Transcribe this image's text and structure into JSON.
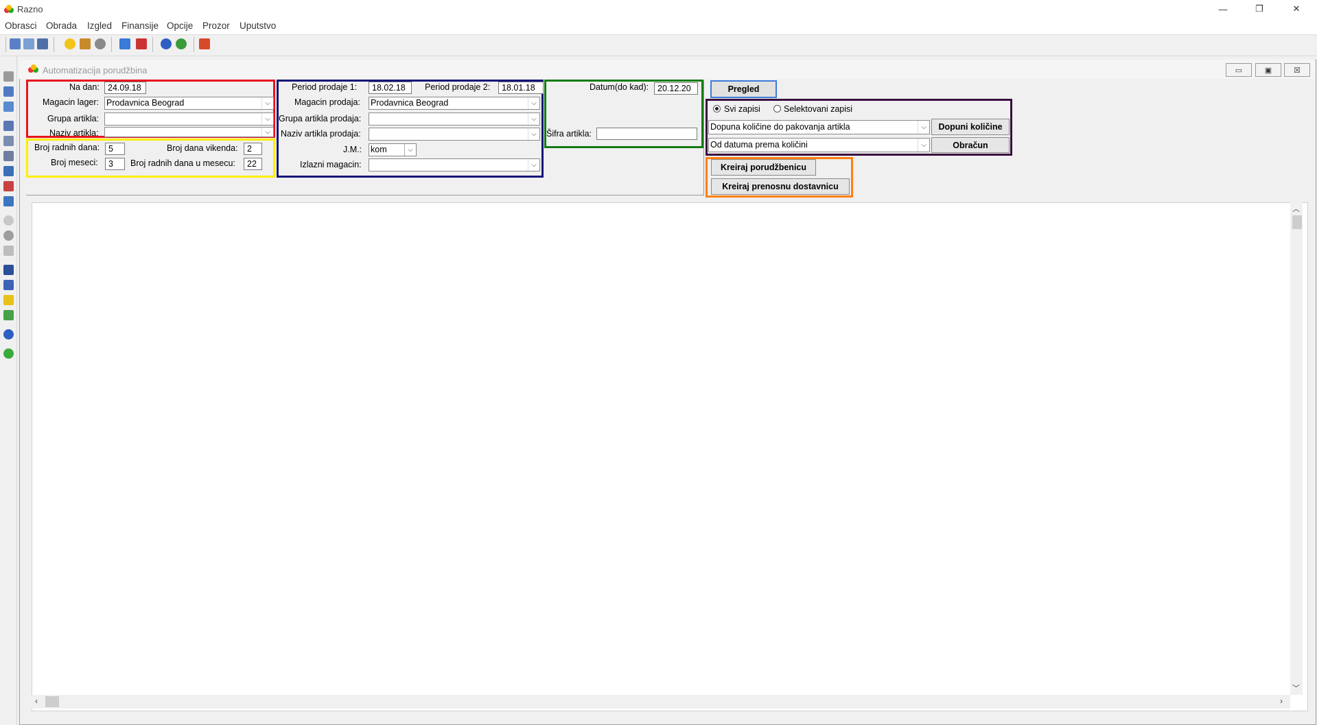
{
  "app": {
    "title": "Razno"
  },
  "window_controls": {
    "minimize": "—",
    "restore": "❐",
    "close": "✕"
  },
  "menu": [
    "Obrasci",
    "Obrada",
    "Izgled",
    "Finansije",
    "Opcije",
    "Prozor",
    "Uputstvo"
  ],
  "child": {
    "title": "Automatizacija porudžbina",
    "controls": {
      "minimize": "▭",
      "restore": "▣",
      "close": "☒"
    }
  },
  "red_section": {
    "na_dan_label": "Na dan:",
    "na_dan_value": "24.09.18",
    "magacin_lager_label": "Magacin lager:",
    "magacin_lager_value": "Prodavnica Beograd",
    "grupa_artikla_label": "Grupa artikla:",
    "grupa_artikla_value": "",
    "naziv_artikla_label": "Naziv artikla:",
    "naziv_artikla_value": ""
  },
  "yellow_section": {
    "broj_radnih_dana_label": "Broj radnih dana:",
    "broj_radnih_dana_value": "5",
    "broj_dana_vikenda_label": "Broj dana vikenda:",
    "broj_dana_vikenda_value": "2",
    "broj_meseci_label": "Broj meseci:",
    "broj_meseci_value": "3",
    "broj_radnih_dana_mesec_label": "Broj radnih dana u mesecu:",
    "broj_radnih_dana_mesec_value": "22"
  },
  "blue_section": {
    "period1_label": "Period prodaje 1:",
    "period1_value": "18.02.18",
    "period2_label": "Period prodaje 2:",
    "period2_value": "18.01.18",
    "magacin_prodaja_label": "Magacin prodaja:",
    "magacin_prodaja_value": "Prodavnica Beograd",
    "grupa_prodaja_label": "Grupa artikla prodaja:",
    "grupa_prodaja_value": "",
    "naziv_prodaja_label": "Naziv artikla prodaja:",
    "naziv_prodaja_value": "",
    "jm_label": "J.M.:",
    "jm_value": "kom",
    "izlazni_label": "Izlazni magacin:",
    "izlazni_value": ""
  },
  "green_section": {
    "datum_label": "Datum(do kad):",
    "datum_value": "20.12.20",
    "sifra_label": "Šifra artikla:",
    "sifra_value": ""
  },
  "actions": {
    "pregled": "Pregled",
    "radio_all": "Svi zapisi",
    "radio_selected": "Selektovani zapisi",
    "combo1_value": "Dopuna količine do pakovanja artikla",
    "combo2_value": "Od datuma prema količini",
    "dopuni_kolicine": "Dopuni količine",
    "obracun": "Obračun",
    "kreiraj_porudzbenicu": "Kreiraj porudžbenicu",
    "kreiraj_dostavnicu": "Kreiraj prenosnu dostavnicu"
  },
  "frame_colors": {
    "red": "#e8131b",
    "yellow": "#ffee00",
    "blue": "#14137a",
    "green": "#127b12",
    "purple": "#3a0a3f",
    "orange": "#ff7f10"
  }
}
